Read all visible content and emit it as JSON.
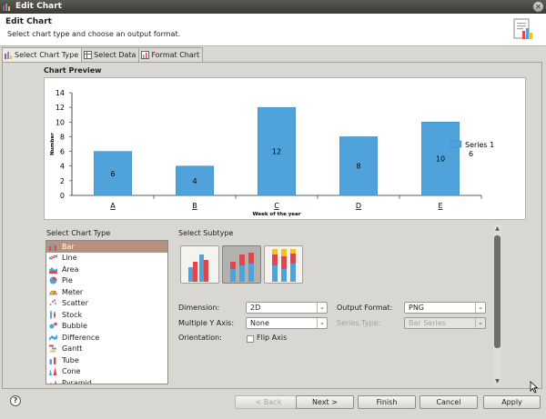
{
  "window": {
    "title": "Edit Chart"
  },
  "header": {
    "title": "Edit Chart",
    "subtitle": "Select chart type and choose an output format."
  },
  "tabs": [
    {
      "label": "Select Chart Type"
    },
    {
      "label": "Select Data"
    },
    {
      "label": "Format Chart"
    }
  ],
  "preview": {
    "label": "Chart Preview"
  },
  "chart_data": {
    "type": "bar",
    "categories": [
      "A",
      "B",
      "C",
      "D",
      "E"
    ],
    "series": [
      {
        "name": "Series 1",
        "values": [
          6,
          4,
          12,
          8,
          10
        ]
      }
    ],
    "title": "",
    "xlabel": "Week of the year",
    "ylabel": "Number",
    "ylim": [
      0,
      14
    ],
    "yticks": [
      "0",
      "2",
      "4",
      "6",
      "8",
      "10",
      "12",
      "14"
    ],
    "legend_position": "right",
    "legend_value": "6",
    "bar_color": "#4fa3da",
    "grid": false
  },
  "chart_type": {
    "label": "Select Chart Type",
    "items": [
      {
        "label": "Bar",
        "icon": "bar-chart-icon"
      },
      {
        "label": "Line",
        "icon": "line-chart-icon"
      },
      {
        "label": "Area",
        "icon": "area-chart-icon"
      },
      {
        "label": "Pie",
        "icon": "pie-chart-icon"
      },
      {
        "label": "Meter",
        "icon": "meter-chart-icon"
      },
      {
        "label": "Scatter",
        "icon": "scatter-chart-icon"
      },
      {
        "label": "Stock",
        "icon": "stock-chart-icon"
      },
      {
        "label": "Bubble",
        "icon": "bubble-chart-icon"
      },
      {
        "label": "Difference",
        "icon": "difference-chart-icon"
      },
      {
        "label": "Gantt",
        "icon": "gantt-chart-icon"
      },
      {
        "label": "Tube",
        "icon": "tube-chart-icon"
      },
      {
        "label": "Cone",
        "icon": "cone-chart-icon"
      },
      {
        "label": "Pyramid",
        "icon": "pyramid-chart-icon"
      }
    ],
    "selected": "Bar"
  },
  "subtype": {
    "label": "Select Subtype",
    "options": [
      "side-by-side-bar-icon",
      "stacked-bar-icon",
      "percent-stacked-bar-icon"
    ],
    "selected_index": 1
  },
  "options": {
    "dimension_label": "Dimension:",
    "dimension_value": "2D",
    "multi_y_label": "Multiple Y Axis:",
    "multi_y_value": "None",
    "orientation_label": "Orientation:",
    "flip_axis_label": "Flip Axis",
    "flip_axis_checked": false,
    "output_format_label": "Output Format:",
    "output_format_value": "PNG",
    "series_type_label": "Series Type:",
    "series_type_value": "Bar Series"
  },
  "buttons": {
    "back": "< Back",
    "next": "Next >",
    "finish": "Finish",
    "cancel": "Cancel",
    "apply": "Apply"
  },
  "colors": {
    "accent_selection": "#b8917d",
    "bar_blue": "#4fa3da",
    "bar_red": "#e0474c",
    "bar_yellow": "#f0c22a"
  }
}
